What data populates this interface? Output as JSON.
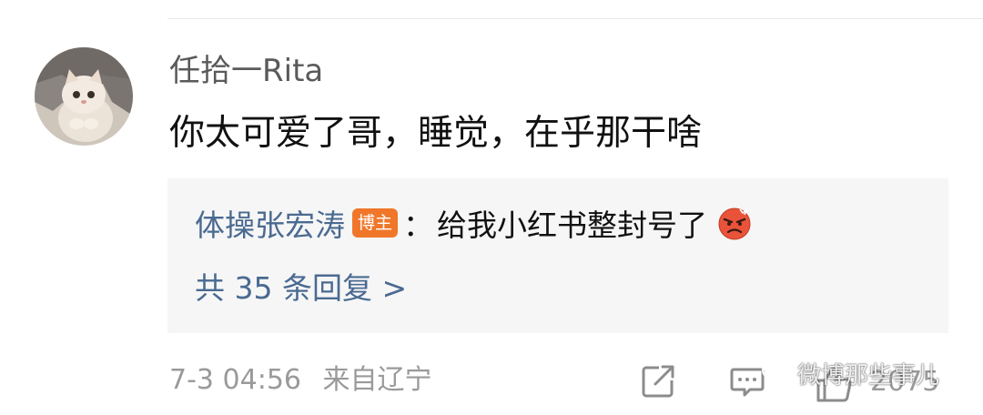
{
  "comment": {
    "username": "任拾一Rita",
    "text": "你太可爱了哥，睡觉，在乎那干啥",
    "avatar_icon": "cat-avatar"
  },
  "reply": {
    "author": "体操张宏涛",
    "badge": "博主",
    "colon": "：",
    "text": "给我小红书整封号了",
    "emoji": "angry-face-emoji",
    "count_label": "共 35 条回复 >"
  },
  "meta": {
    "date": "7-3 04:56",
    "location": "来自辽宁"
  },
  "actions": {
    "share_icon": "share-icon",
    "comment_icon": "comment-icon",
    "like_icon": "thumbs-up-icon",
    "like_count": "2075"
  },
  "watermark": {
    "text": "微博那些事儿",
    "icon": "wechat-icon"
  },
  "colors": {
    "link_blue": "#4a6a91",
    "badge_orange": "#f0772a",
    "reply_bg": "#f6f6f6",
    "meta_gray": "#9a9a9a"
  }
}
